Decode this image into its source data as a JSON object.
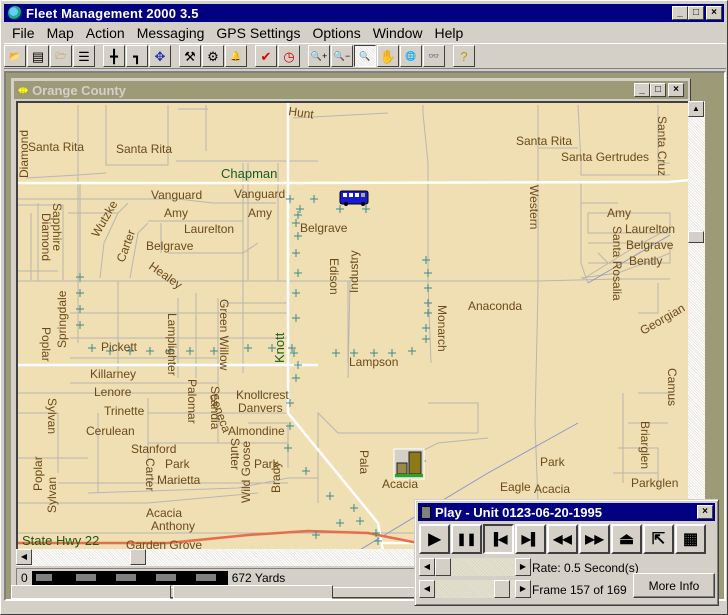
{
  "app": {
    "title": "Fleet Management 2000 3.5",
    "window_buttons": [
      "_",
      "□",
      "×"
    ]
  },
  "menu": [
    "File",
    "Map",
    "Action",
    "Messaging",
    "GPS Settings",
    "Options",
    "Window",
    "Help"
  ],
  "toolbar": {
    "groups": [
      [
        {
          "name": "open-folder-icon",
          "glyph": "📂"
        },
        {
          "name": "vehicle-disabled-icon",
          "glyph": "▤"
        },
        {
          "name": "open-map-icon",
          "glyph": "🗁"
        },
        {
          "name": "list-icon",
          "glyph": "☰"
        }
      ],
      [
        {
          "name": "route-fork-icon",
          "glyph": "╋"
        },
        {
          "name": "route-path-icon",
          "glyph": "┓"
        },
        {
          "name": "move-arrows-icon",
          "glyph": "✥"
        }
      ],
      [
        {
          "name": "tools-icon",
          "glyph": "⚒"
        },
        {
          "name": "gears-icon",
          "glyph": "⚙"
        },
        {
          "name": "bell-icon",
          "glyph": "🔔"
        }
      ],
      [
        {
          "name": "check-icon",
          "glyph": "✔"
        },
        {
          "name": "clock-icon",
          "glyph": "◷"
        }
      ],
      [
        {
          "name": "zoom-in-icon",
          "glyph": "🔍+"
        },
        {
          "name": "zoom-out-icon",
          "glyph": "🔍−"
        },
        {
          "name": "zoom-select-icon",
          "glyph": "🔍",
          "pressed": true
        },
        {
          "name": "pan-hand-icon",
          "glyph": "✋"
        },
        {
          "name": "globe-icon",
          "glyph": "🌐"
        },
        {
          "name": "binoculars-icon",
          "glyph": "👓"
        }
      ],
      [
        {
          "name": "help-icon",
          "glyph": "?"
        }
      ]
    ]
  },
  "map_window": {
    "title": "Orange County",
    "scale": {
      "start": "0",
      "end": "672 Yards"
    },
    "streets": {
      "major": [
        "Chapman",
        "Knott",
        "State Hwy 22"
      ],
      "minor": [
        "Hunt",
        "Santa Rita",
        "Santa Rita",
        "Scandia",
        "Diamond",
        "Santa Rita",
        "Santa Gertrudes",
        "Santa Cruz",
        "Western",
        "Vanguard",
        "Vanguard",
        "Amy",
        "Amy",
        "Amy",
        "Wutzke",
        "Laurelton",
        "Laurelton",
        "Sapphire",
        "Diamond",
        "Carter",
        "Belgrave",
        "Belgrave",
        "Belgrave",
        "Healey",
        "Industry",
        "Edison",
        "Santa Rosalia",
        "Bently",
        "Anaconda",
        "Georgian",
        "Monarch",
        "Springdale",
        "Poplar",
        "Pickett",
        "Lamplighter",
        "Green Willow",
        "Lampson",
        "Killarney",
        "Lenore",
        "Knollcrest",
        "Camus",
        "Trinette",
        "Palomar",
        "Scandia",
        "Danvers",
        "Sylvan",
        "Cerulean",
        "Almondine",
        "Briarglen",
        "Stanford",
        "Park",
        "Park",
        "Park",
        "Marietta",
        "Carter",
        "Sutter",
        "Wild Goose",
        "Brady",
        "Pala",
        "Acacia",
        "Acacia",
        "Acacia",
        "Eagle",
        "Parkglen",
        "Poplar",
        "Sylvan",
        "Seneca",
        "Anthony",
        "Garden Grove"
      ]
    }
  },
  "play_window": {
    "title": "Play - Unit 0123-06-20-1995",
    "buttons": [
      {
        "name": "play-button",
        "icon": "play-icon",
        "glyph": "▶"
      },
      {
        "name": "pause-button",
        "icon": "pause-icon",
        "glyph": "❚❚"
      },
      {
        "name": "first-frame-button",
        "icon": "skip-back-icon",
        "glyph": "▐◀",
        "pressed": true
      },
      {
        "name": "last-frame-button",
        "icon": "skip-forward-icon",
        "glyph": "▶▌"
      },
      {
        "name": "rewind-button",
        "icon": "rewind-icon",
        "glyph": "◀◀"
      },
      {
        "name": "fast-forward-button",
        "icon": "fast-forward-icon",
        "glyph": "▶▶"
      },
      {
        "name": "eject-button",
        "icon": "eject-icon",
        "glyph": "⏏"
      },
      {
        "name": "export-button",
        "icon": "export-icon",
        "glyph": "⇱"
      },
      {
        "name": "properties-button",
        "icon": "properties-icon",
        "glyph": "▦"
      }
    ],
    "rate_label": "Rate: 0.5 Second(s)",
    "rate_fraction": 0.0,
    "frame_label": "Frame 157 of 169",
    "frame_current": 157,
    "frame_total": 169,
    "more_info_label": "More Info"
  }
}
